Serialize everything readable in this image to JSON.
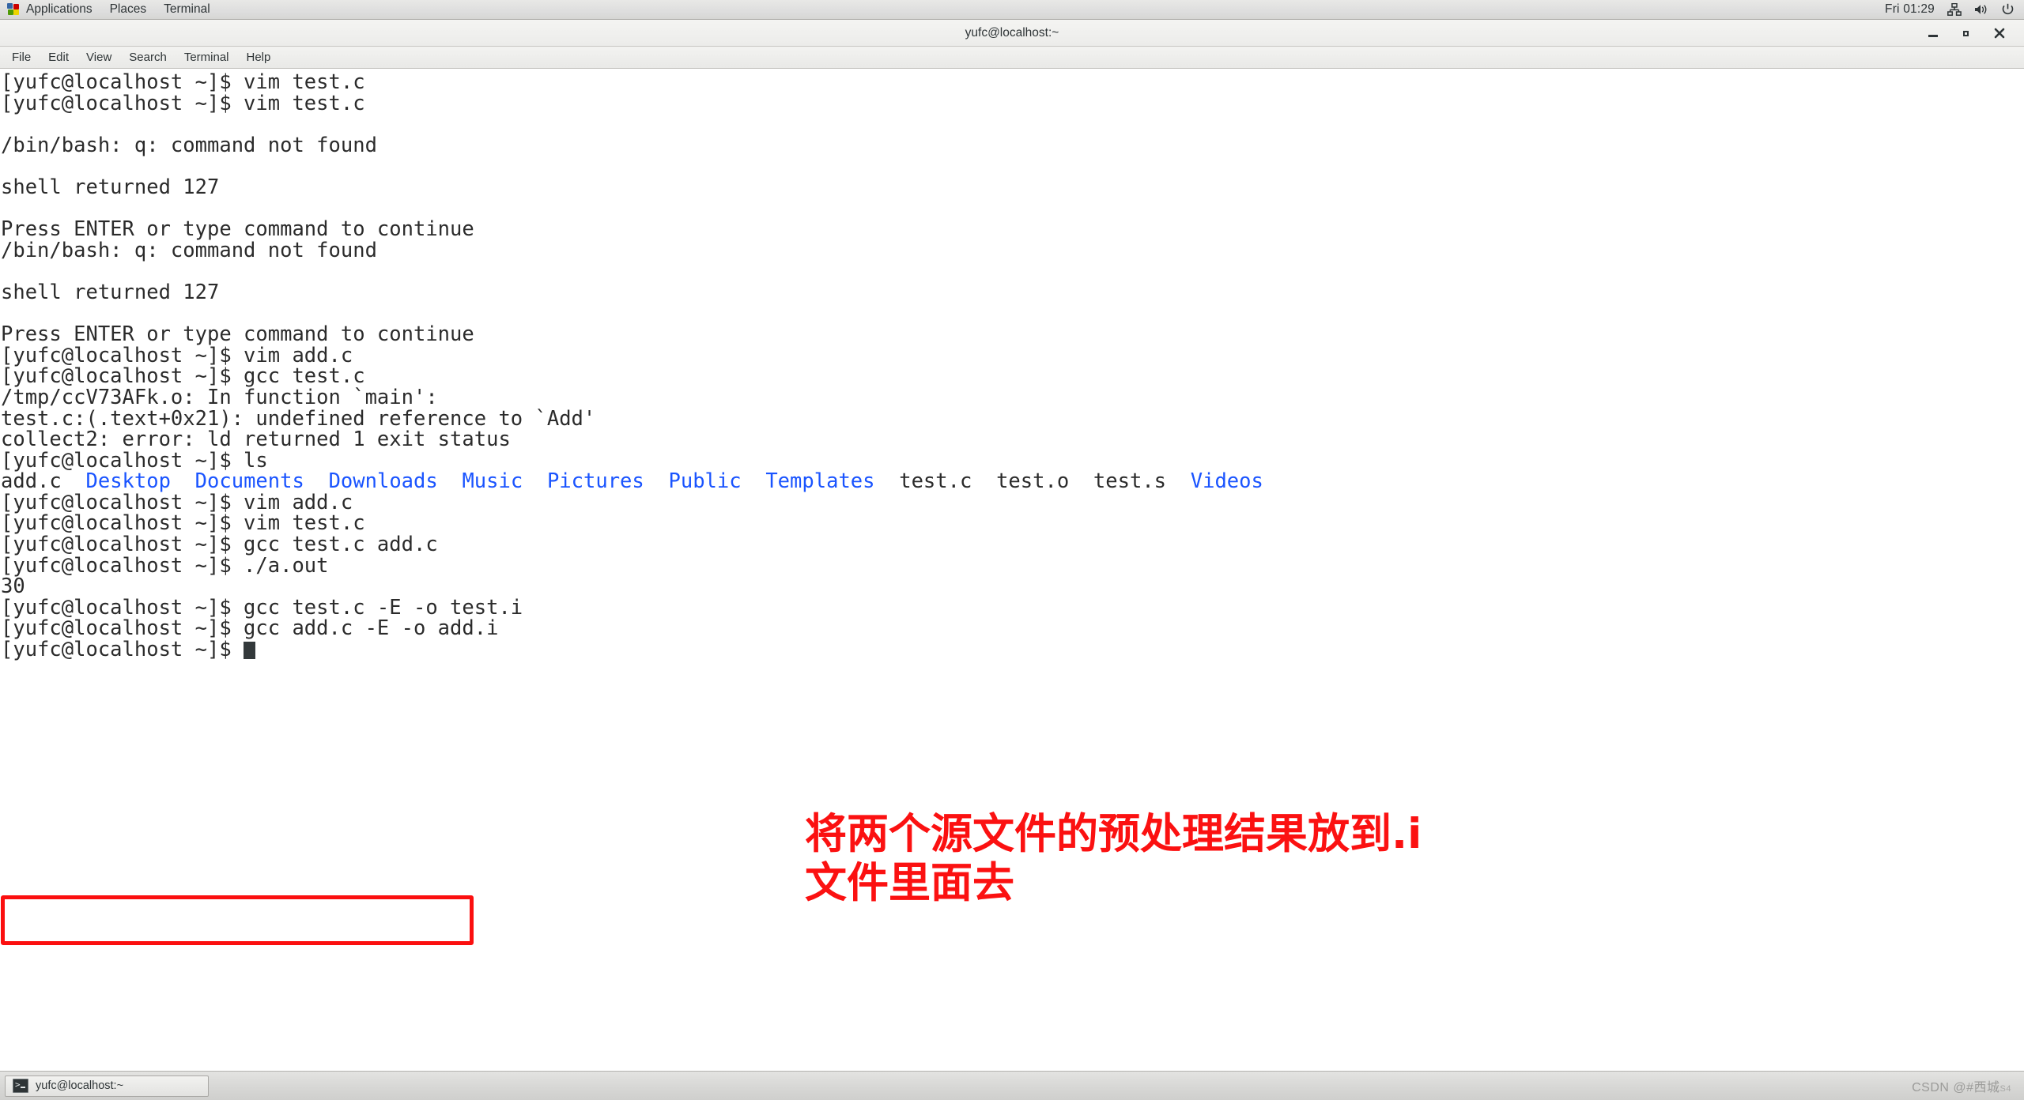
{
  "top_panel": {
    "apps_icon": "applications-grid-icon",
    "items": [
      {
        "label": "Applications"
      },
      {
        "label": "Places"
      },
      {
        "label": "Terminal"
      }
    ],
    "clock": "Fri 01:29",
    "tray": [
      {
        "name": "network-icon"
      },
      {
        "name": "volume-icon"
      },
      {
        "name": "power-icon"
      }
    ]
  },
  "window": {
    "title": "yufc@localhost:~",
    "buttons": {
      "minimize": "minimize-button",
      "maximize": "maximize-button",
      "close": "close-button"
    },
    "menubar": [
      {
        "label": "File"
      },
      {
        "label": "Edit"
      },
      {
        "label": "View"
      },
      {
        "label": "Search"
      },
      {
        "label": "Terminal"
      },
      {
        "label": "Help"
      }
    ]
  },
  "terminal": {
    "prompt": "[yufc@localhost ~]$ ",
    "lines": [
      {
        "text": "[yufc@localhost ~]$ vim test.c"
      },
      {
        "text": "[yufc@localhost ~]$ vim test.c"
      },
      {
        "text": ""
      },
      {
        "text": "/bin/bash: q: command not found"
      },
      {
        "text": ""
      },
      {
        "text": "shell returned 127"
      },
      {
        "text": ""
      },
      {
        "text": "Press ENTER or type command to continue"
      },
      {
        "text": "/bin/bash: q: command not found"
      },
      {
        "text": ""
      },
      {
        "text": "shell returned 127"
      },
      {
        "text": ""
      },
      {
        "text": "Press ENTER or type command to continue"
      },
      {
        "text": "[yufc@localhost ~]$ vim add.c"
      },
      {
        "text": "[yufc@localhost ~]$ gcc test.c"
      },
      {
        "text": "/tmp/ccV73AFk.o: In function `main':"
      },
      {
        "text": "test.c:(.text+0x21): undefined reference to `Add'"
      },
      {
        "text": "collect2: error: ld returned 1 exit status"
      },
      {
        "text": "[yufc@localhost ~]$ ls"
      },
      {
        "text": "__LS_ROW__"
      },
      {
        "text": "[yufc@localhost ~]$ vim add.c"
      },
      {
        "text": "[yufc@localhost ~]$ vim test.c"
      },
      {
        "text": "[yufc@localhost ~]$ gcc test.c add.c"
      },
      {
        "text": "[yufc@localhost ~]$ ./a.out"
      },
      {
        "text": "30"
      },
      {
        "text": "[yufc@localhost ~]$ gcc test.c -E -o test.i"
      },
      {
        "text": "[yufc@localhost ~]$ gcc add.c -E -o add.i"
      },
      {
        "text": "__LAST_PROMPT__"
      }
    ],
    "ls_output": [
      {
        "name": "add.c",
        "type": "file"
      },
      {
        "name": "Desktop",
        "type": "dir"
      },
      {
        "name": "Documents",
        "type": "dir"
      },
      {
        "name": "Downloads",
        "type": "dir"
      },
      {
        "name": "Music",
        "type": "dir"
      },
      {
        "name": "Pictures",
        "type": "dir"
      },
      {
        "name": "Public",
        "type": "dir"
      },
      {
        "name": "Templates",
        "type": "dir"
      },
      {
        "name": "test.c",
        "type": "file"
      },
      {
        "name": "test.o",
        "type": "file"
      },
      {
        "name": "test.s",
        "type": "file"
      },
      {
        "name": "Videos",
        "type": "dir"
      }
    ],
    "colors": {
      "foreground": "#2b2b2b",
      "background": "#ffffff",
      "directory": "#1a54ff"
    }
  },
  "annotation": {
    "color": "#fb1111",
    "line1": "将两个源文件的预处理结果放到.i",
    "line2": "文件里面去",
    "highlight_box": "red-rectangle-highlight"
  },
  "bottom_panel": {
    "task_button": {
      "label": "yufc@localhost:~",
      "icon": "terminal-icon"
    },
    "watermark": "CSDN @#西城",
    "watermark_sub": "S4"
  }
}
